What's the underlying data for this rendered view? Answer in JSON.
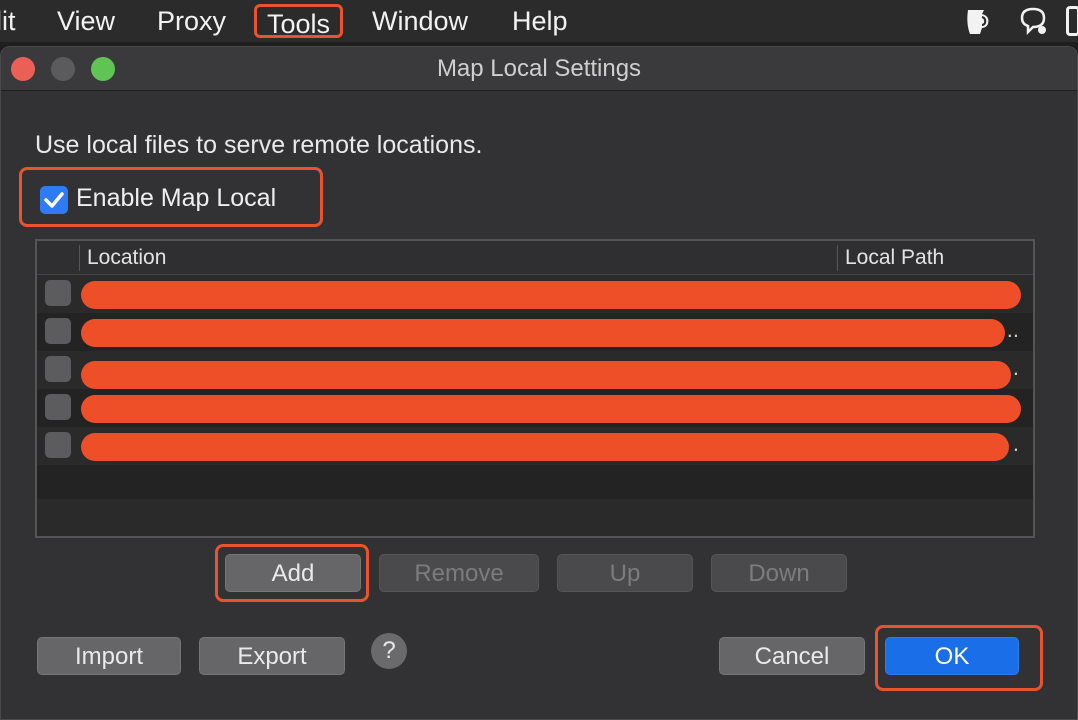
{
  "menubar": {
    "items": [
      {
        "label": "lit"
      },
      {
        "label": "View"
      },
      {
        "label": "Proxy"
      },
      {
        "label": "Tools",
        "highlighted": true
      },
      {
        "label": "Window"
      },
      {
        "label": "Help"
      }
    ],
    "icons": [
      "charles-jug-icon",
      "chat-bubble-icon"
    ]
  },
  "window": {
    "title": "Map Local Settings",
    "description": "Use local files to serve remote locations.",
    "enable_label": "Enable Map Local",
    "enable_checked": true,
    "table": {
      "columns": [
        "Location",
        "Local Path"
      ],
      "rows": [
        {
          "enabled": false,
          "location": "[redacted]",
          "local_path": "[redacted]"
        },
        {
          "enabled": false,
          "location": "[redacted]",
          "local_path": "[redacted]"
        },
        {
          "enabled": false,
          "location": "[redacted]",
          "local_path": "[redacted]"
        },
        {
          "enabled": false,
          "location": "[redacted]",
          "local_path": "[redacted]"
        },
        {
          "enabled": false,
          "location": "[redacted]",
          "local_path": "[redacted]"
        }
      ]
    },
    "buttons": {
      "add": "Add",
      "remove": "Remove",
      "up": "Up",
      "down": "Down",
      "import": "Import",
      "export": "Export",
      "help": "?",
      "cancel": "Cancel",
      "ok": "OK"
    }
  },
  "colors": {
    "highlight": "#e8542e",
    "accent": "#1a6fe8",
    "close": "#ec5f57",
    "minimize": "#5b5b5d",
    "zoom": "#5fc454"
  }
}
